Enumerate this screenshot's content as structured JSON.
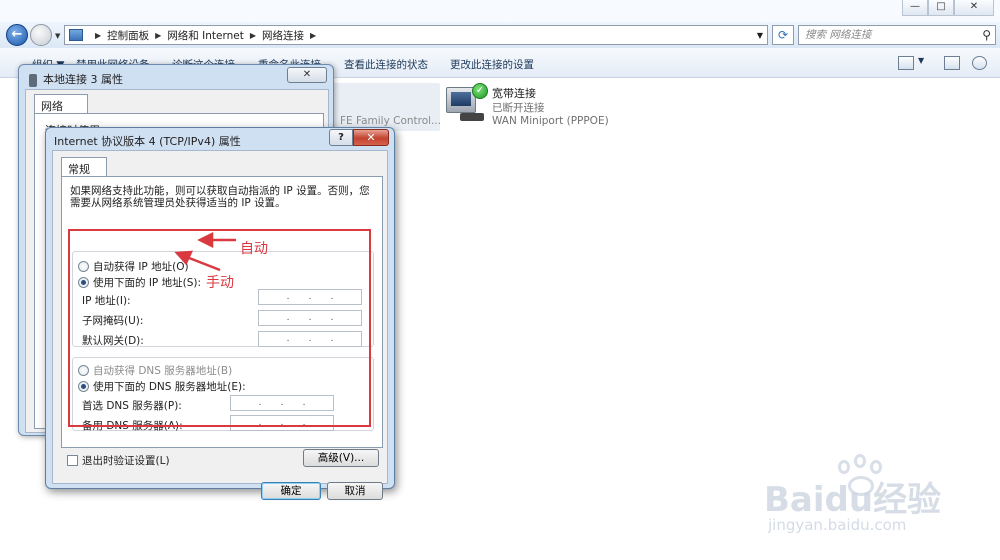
{
  "explorer": {
    "breadcrumb": [
      "控制面板",
      "网络和 Internet",
      "网络连接"
    ],
    "search_placeholder": "搜索 网络连接",
    "toolbar": {
      "organize": "组织 ▼",
      "disable": "禁用此网络设备",
      "diagnose": "诊断这个连接",
      "rename": "重命名此连接",
      "view_status": "查看此连接的状态",
      "change_settings": "更改此连接的设置"
    },
    "connections": [
      {
        "partial_label": "FE Family Control..."
      },
      {
        "name": "宽带连接",
        "status": "已断开连接",
        "device": "WAN Miniport (PPPOE)"
      }
    ]
  },
  "properties_dialog": {
    "title": "本地连接 3 属性",
    "tab": "网络",
    "connect_label": "连接时使用:"
  },
  "ipv4_dialog": {
    "title": "Internet 协议版本 4 (TCP/IPv4) 属性",
    "help": "?",
    "close": "✕",
    "tab": "常规",
    "description": "如果网络支持此功能，则可以获取自动指派的 IP 设置。否则，您需要从网络系统管理员处获得适当的 IP 设置。",
    "auto_ip": "自动获得 IP 地址(O)",
    "manual_ip": "使用下面的 IP 地址(S):",
    "ip_address": "IP 地址(I):",
    "subnet_mask": "子网掩码(U):",
    "gateway": "默认网关(D):",
    "auto_dns": "自动获得 DNS 服务器地址(B)",
    "manual_dns": "使用下面的 DNS 服务器地址(E):",
    "preferred_dns": "首选 DNS 服务器(P):",
    "alternate_dns": "备用 DNS 服务器(A):",
    "validate": "退出时验证设置(L)",
    "advanced": "高级(V)...",
    "ok": "确定",
    "cancel": "取消",
    "ip_dots": "  .    .    .",
    "selected_ip_mode": "manual",
    "selected_dns_mode": "manual"
  },
  "annotations": {
    "auto_label": "自动",
    "manual_label": "手动",
    "color": "#d9393f"
  },
  "watermark": {
    "brand": "Bai",
    "brand2": "du",
    "brand3": "经验",
    "url": "jingyan.baidu.com"
  }
}
